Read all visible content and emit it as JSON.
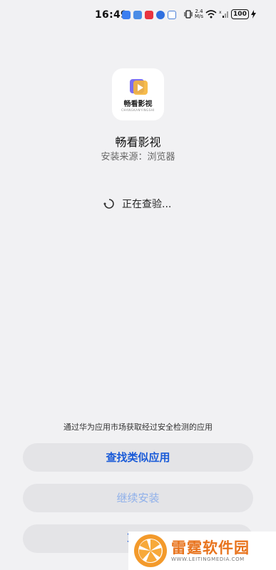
{
  "status_bar": {
    "time": "16:49",
    "net_speed_value": "2.4",
    "net_speed_unit": "M/s",
    "battery": "100"
  },
  "app": {
    "icon_title": "畅看影视",
    "icon_subtitle": "CHANGKANYINGSHI",
    "name": "畅看影视",
    "source": "安装来源：浏览器"
  },
  "progress": {
    "status_text": "正在查验..."
  },
  "footer": {
    "market_note": "通过华为应用市场获取经过安全检测的应用",
    "find_similar_label": "查找类似应用",
    "continue_install_label": "继续安装",
    "cancel_label": "取消"
  },
  "watermark": {
    "title": "雷霆软件园",
    "url": "WWW.LEITINGMEDIA.COM"
  },
  "colors": {
    "background": "#f1f1f3",
    "button_bg": "#e4e4e7",
    "accent_blue": "#1a5bd8",
    "disabled_blue": "#8fb0ea",
    "watermark_orange": "#e8731c"
  }
}
